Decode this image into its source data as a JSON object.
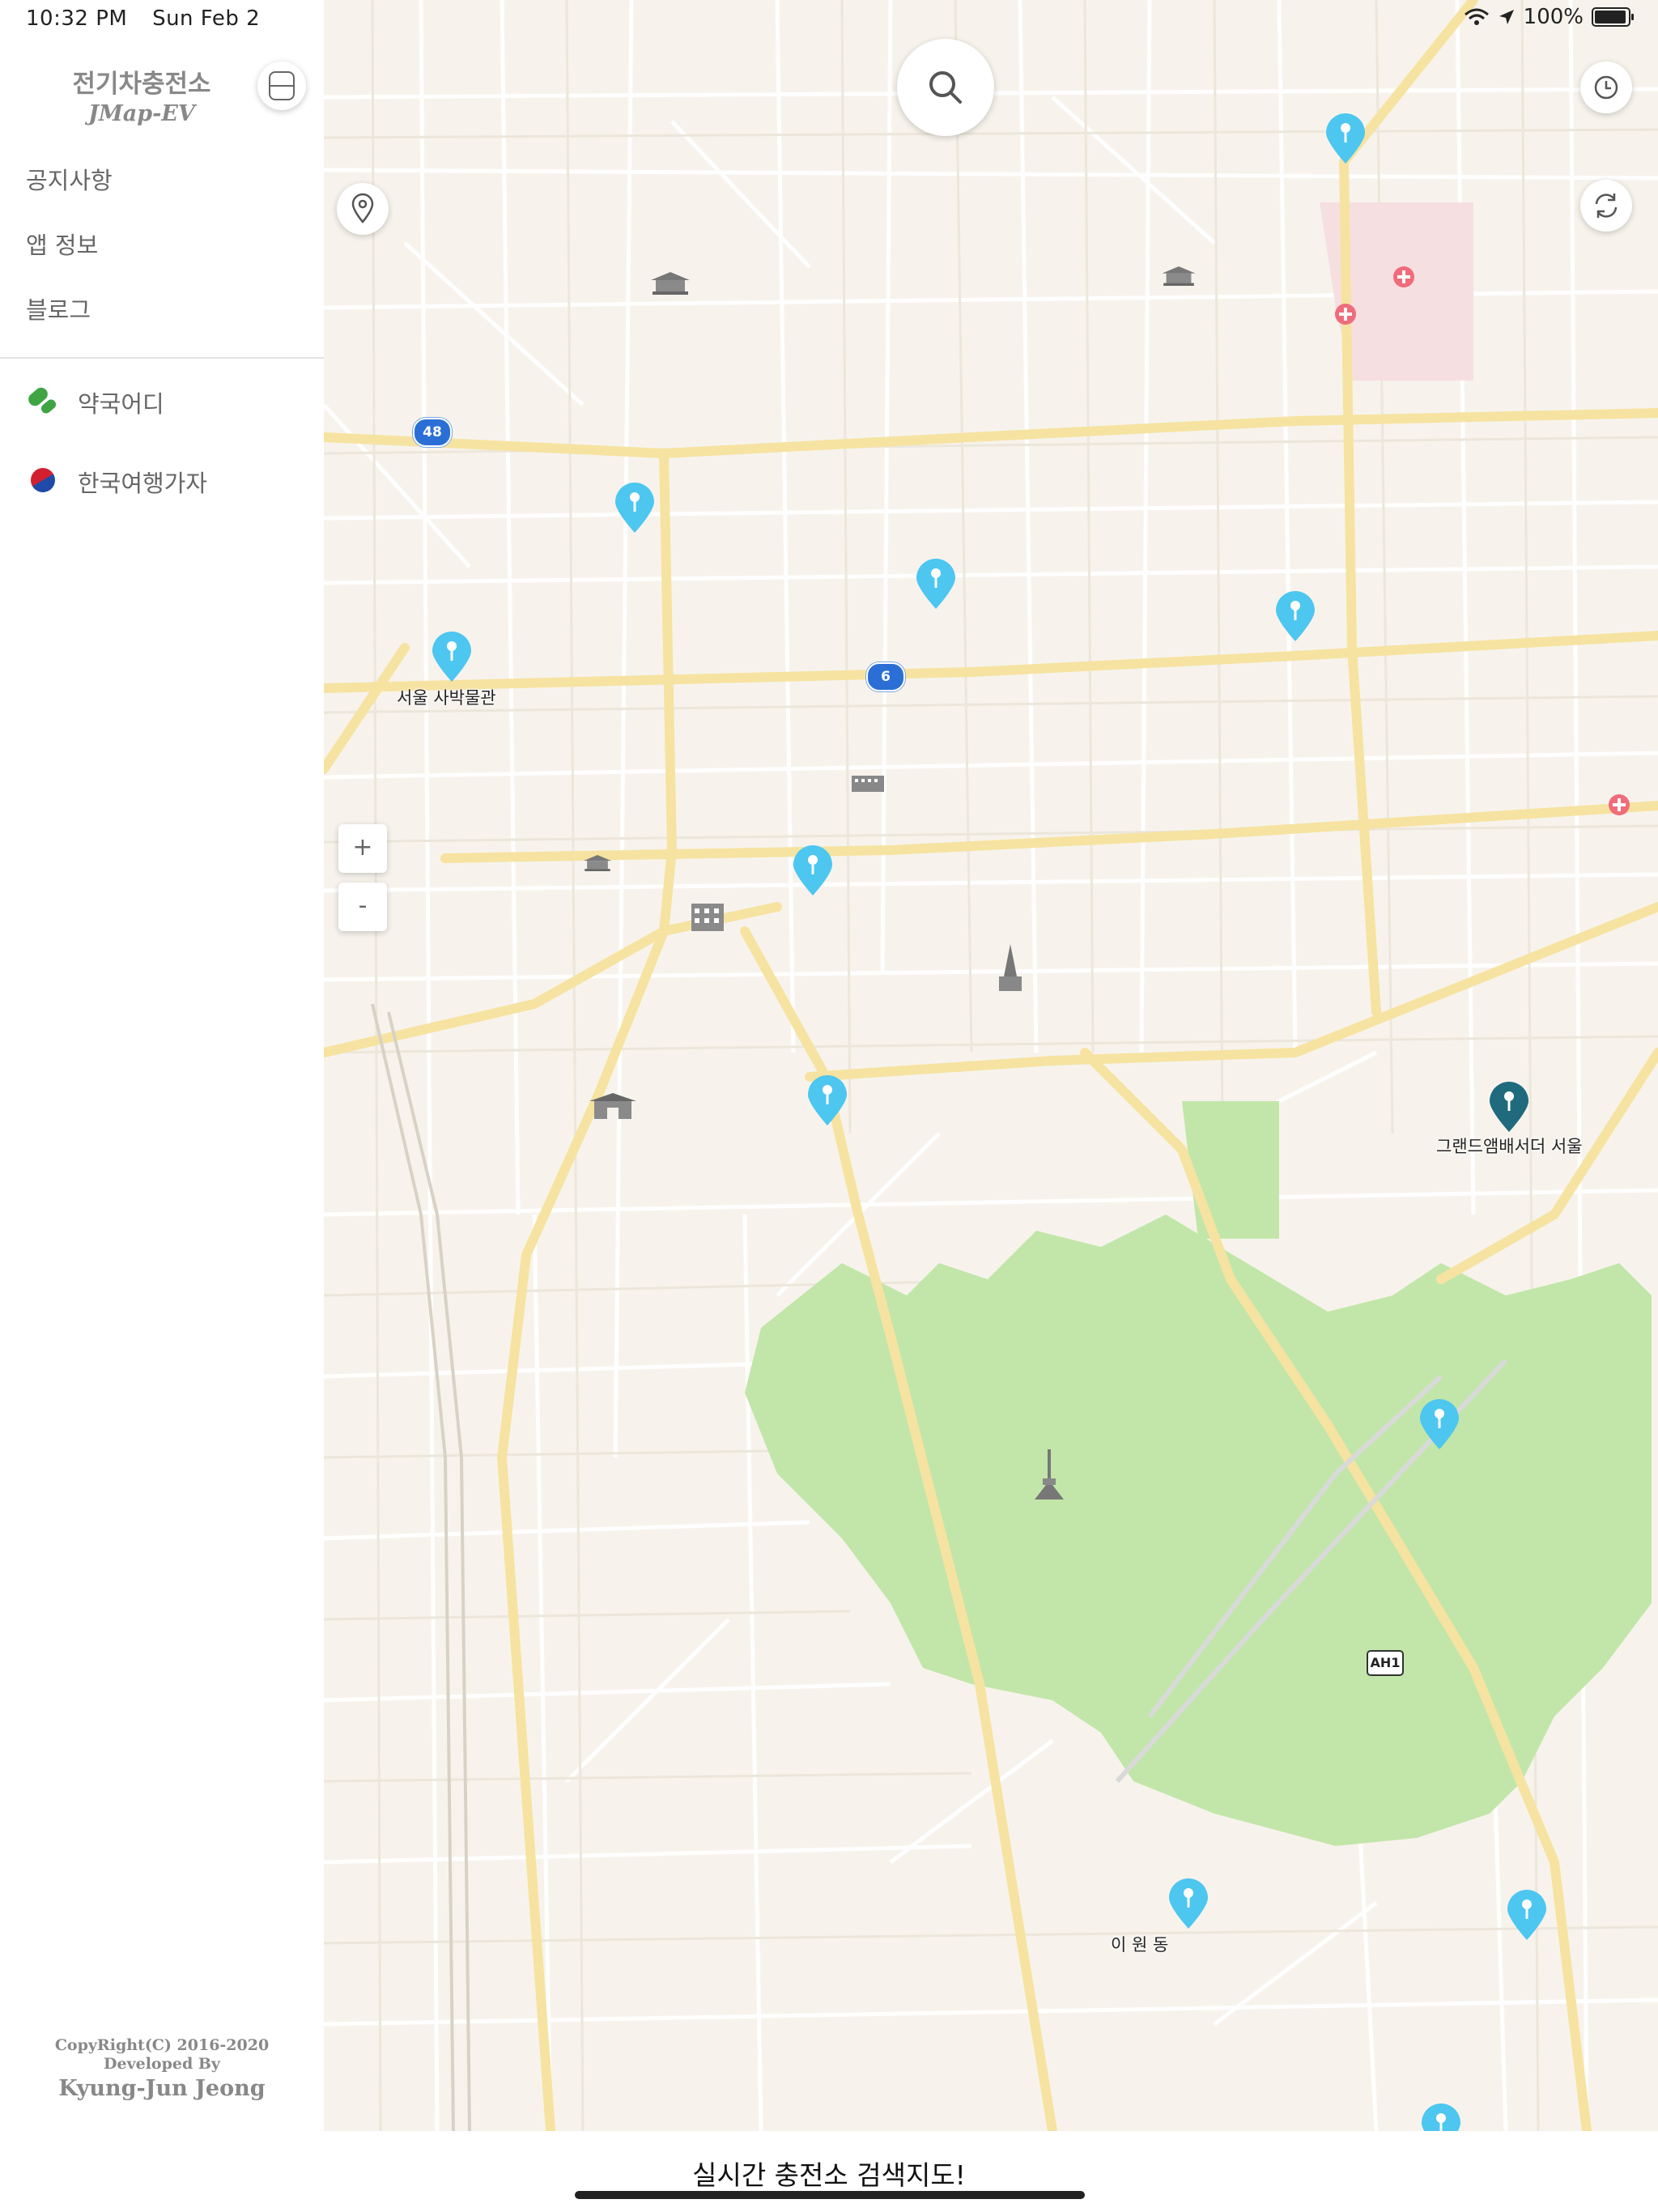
{
  "status_bar": {
    "time": "10:32 PM",
    "date": "Sun Feb 2",
    "battery": "100%"
  },
  "sidebar": {
    "title_kr": "전기차충전소",
    "title_en": "JMap-EV",
    "menu": [
      "공지사항",
      "앱 정보",
      "블로그"
    ],
    "links": [
      {
        "label": "약국어디",
        "icon": "pill-icon"
      },
      {
        "label": "한국여행가자",
        "icon": "taegeuk-icon"
      }
    ],
    "footer": {
      "copyright": "CopyRight(C) 2016-2020",
      "developed_by": "Developed By",
      "author": "Kyung-Jun Jeong"
    }
  },
  "map": {
    "labels": {
      "museum": "서울  사박물관",
      "hotel": "그랜드앰배서더 서울",
      "area": "이 원 동"
    },
    "route_shields": [
      "48",
      "6",
      "AH1"
    ],
    "zoom_in": "+",
    "zoom_out": "-",
    "colors": {
      "pin": "#4dc6f0",
      "pin_selected": "#1f6a7d",
      "park": "#c2e6a9",
      "road_major": "#f6e3a1",
      "land": "#f7f3ec"
    }
  },
  "bottom_bar": {
    "message": "실시간 충전소 검색지도!"
  }
}
